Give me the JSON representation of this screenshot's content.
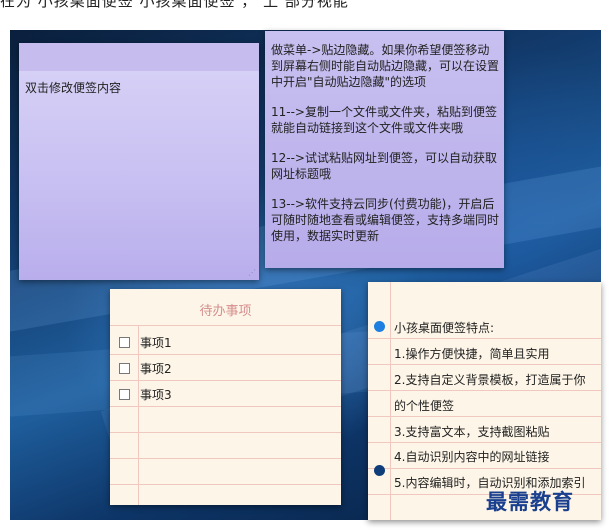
{
  "top_caption": "在为         小孩桌面便签      小孩桌面便签          ，        上   部分视能",
  "note1": {
    "text": "双击修改便签内容"
  },
  "note2": {
    "paragraphs": [
      "做菜单->贴边隐藏。如果你希望便签移动到屏幕右侧时能自动贴边隐藏，可以在设置中开启\"自动贴边隐藏\"的选项",
      "11-->复制一个文件或文件夹，粘贴到便签就能自动链接到这个文件或文件夹哦",
      "12-->试试粘贴网址到便签，可以自动获取网址标题哦",
      "13-->软件支持云同步(付费功能)，开启后可随时随地查看或编辑便签，支持多端同时使用，数据实时更新"
    ]
  },
  "todo": {
    "title": "待办事项",
    "items": [
      "事项1",
      "事项2",
      "事项3"
    ]
  },
  "features": {
    "rows": [
      "小孩桌面便签特点:",
      "1.操作方便快捷，简单且实用",
      "2.支持自定义背景模板，打造属于你",
      "的个性便签",
      "3.支持富文本，支持截图粘贴",
      "4.自动识别内容中的网址链接",
      "5.内容编辑时，自动识别和添加索引"
    ]
  },
  "watermark": "最需教育",
  "colors": {
    "note_purple": "#c9c1f2",
    "note_cream": "#fdf6e8",
    "todo_title": "#d48e8e",
    "bullet_blue": "#1e7fe0",
    "bullet_navy": "#0f3d7a",
    "watermark": "#1a3f8e"
  }
}
